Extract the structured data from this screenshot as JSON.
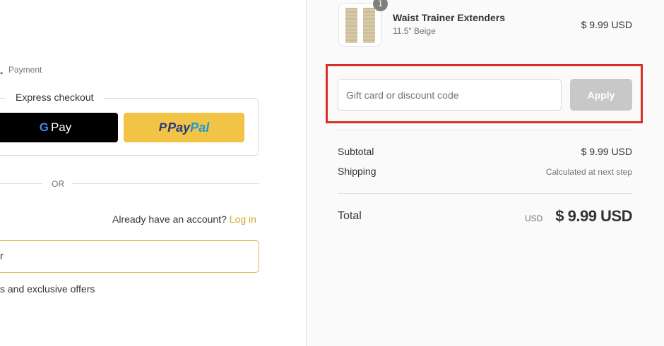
{
  "breadcrumb": {
    "current": "Payment"
  },
  "express": {
    "title": "Express checkout",
    "gpay_label": "Pay",
    "paypal_label_1": "Pay",
    "paypal_label_2": "Pal"
  },
  "divider": {
    "or_text": "OR"
  },
  "account": {
    "prompt": "Already have an account?",
    "login_label": "Log in"
  },
  "contact": {
    "email_value_partial": "r",
    "offers_text_partial": "s and exclusive offers"
  },
  "cart": {
    "items": [
      {
        "name": "Waist Trainer Extenders",
        "variant": "11.5\" Beige",
        "price": "$ 9.99 USD",
        "quantity": "1"
      }
    ]
  },
  "discount": {
    "placeholder": "Gift card or discount code",
    "apply_label": "Apply"
  },
  "summary": {
    "subtotal_label": "Subtotal",
    "subtotal_value": "$ 9.99 USD",
    "shipping_label": "Shipping",
    "shipping_value": "Calculated at next step",
    "total_label": "Total",
    "total_currency": "USD",
    "total_value": "$ 9.99 USD"
  },
  "colors": {
    "highlight": "#d93025",
    "login_link": "#d4a72c",
    "paypal_bg": "#f3c346",
    "apply_disabled": "#c8c8c8"
  }
}
